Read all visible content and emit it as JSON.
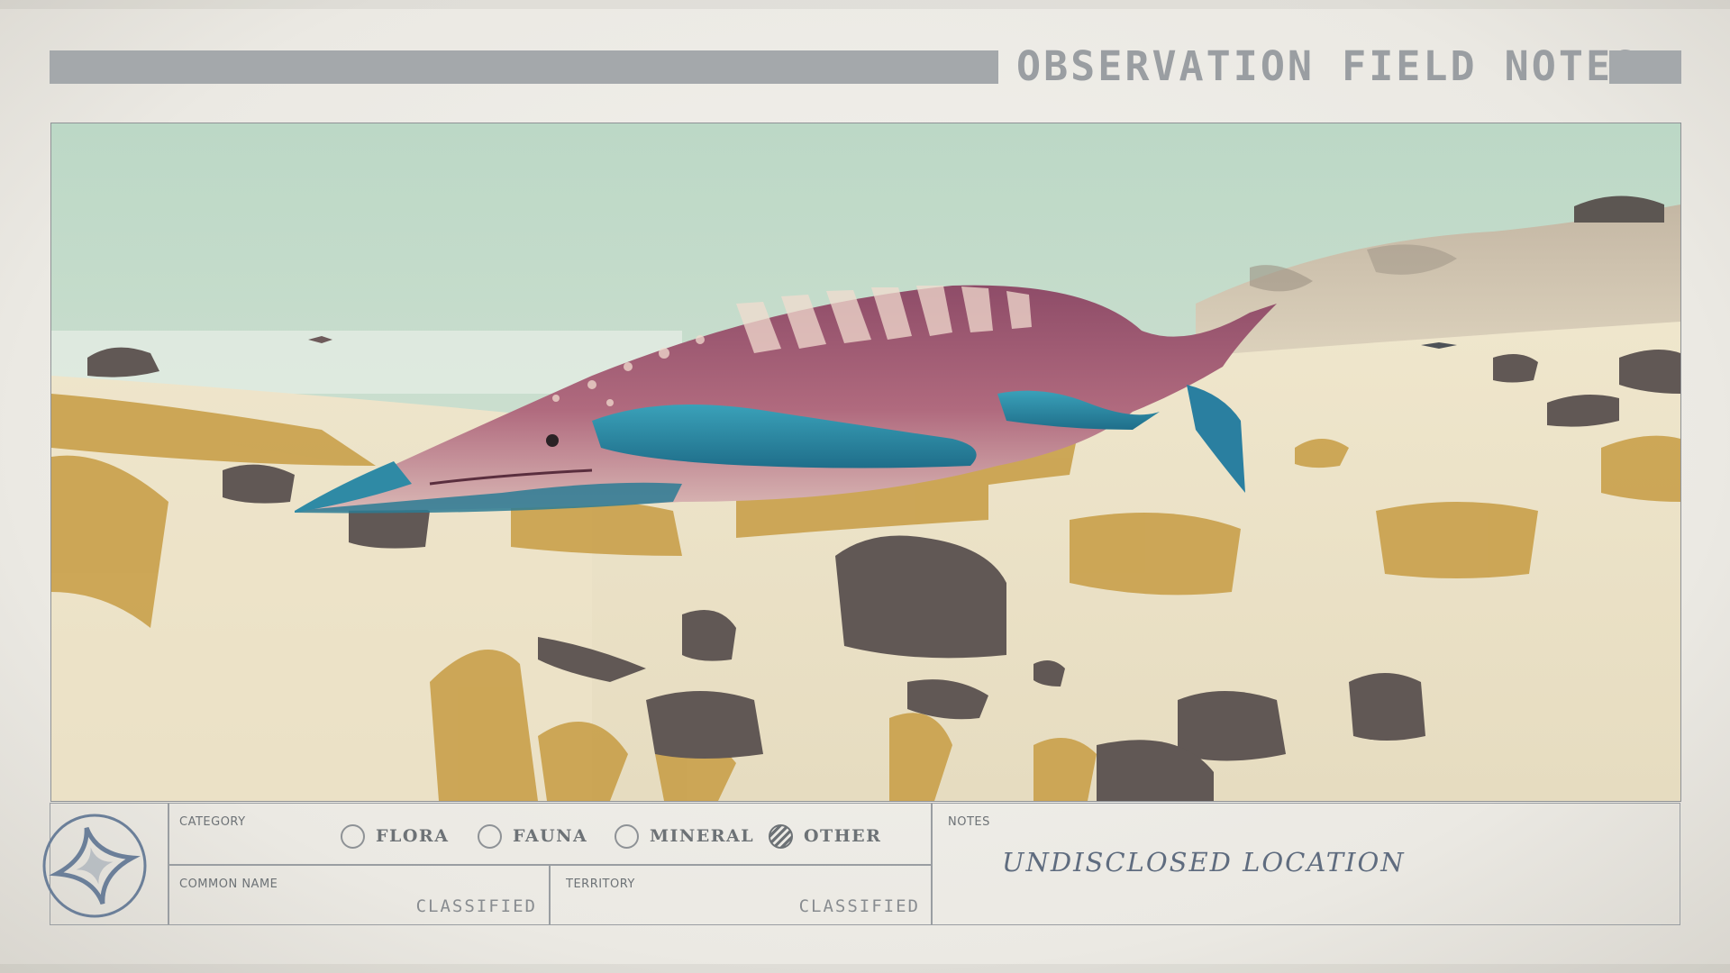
{
  "header": {
    "title": "OBSERVATION FIELD NOTES"
  },
  "photo": {
    "icon": "alien-whale-creature-landscape"
  },
  "form": {
    "category": {
      "label": "CATEGORY",
      "options": [
        {
          "label": "FLORA",
          "selected": false
        },
        {
          "label": "FAUNA",
          "selected": false
        },
        {
          "label": "MINERAL",
          "selected": false
        },
        {
          "label": "OTHER",
          "selected": true
        }
      ]
    },
    "common_name": {
      "label": "COMMON NAME",
      "value": "CLASSIFIED"
    },
    "territory": {
      "label": "TERRITORY",
      "value": "CLASSIFIED"
    },
    "notes": {
      "label": "NOTES",
      "value": "UNDISCLOSED LOCATION"
    }
  },
  "emblem": {
    "icon": "constellation-star-emblem-icon"
  },
  "colors": {
    "paper": "#ebe9e3",
    "ink": "#6d7276",
    "header_bar": "#a4a8ab",
    "handwriting": "#5f6c7f",
    "emblem": "#6b7f99"
  }
}
